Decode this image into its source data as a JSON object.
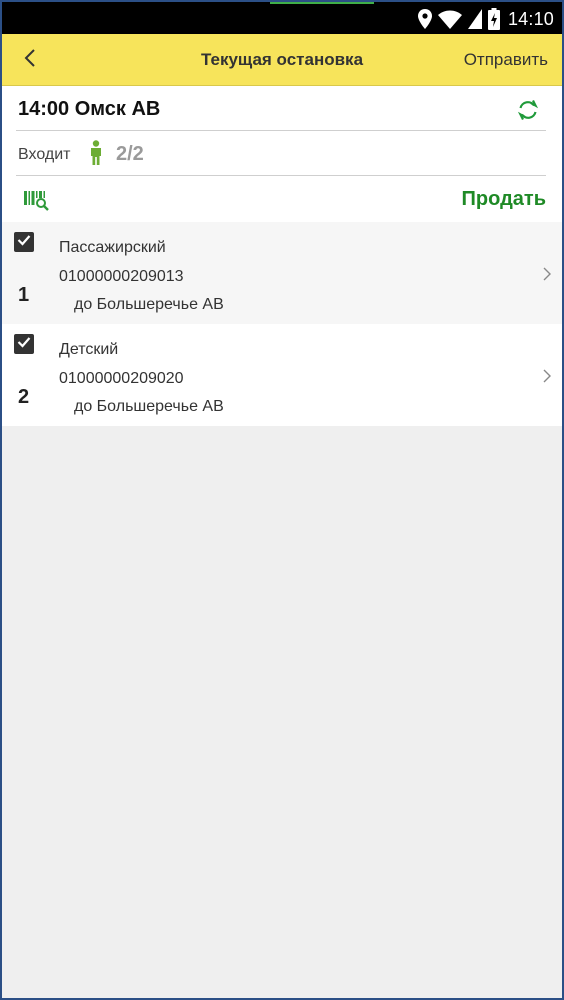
{
  "status_bar": {
    "time": "14:10",
    "icons": [
      "location-icon",
      "wifi-icon",
      "signal-icon",
      "battery-charging-icon"
    ]
  },
  "header": {
    "back_icon": "chevron-left-icon",
    "title": "Текущая остановка",
    "send_label": "Отправить"
  },
  "stop": {
    "title": "14:00 Омск АВ",
    "refresh_icon": "refresh-icon",
    "incoming_label": "Входит",
    "incoming_icon": "person-icon",
    "incoming_count": "2/2",
    "barcode_icon": "barcode-search-icon",
    "sell_label": "Продать"
  },
  "tickets": [
    {
      "checked": true,
      "number": "1",
      "type": "Пассажирский",
      "ticket_no": "01000000209013",
      "destination": "до Большеречье АВ"
    },
    {
      "checked": true,
      "number": "2",
      "type": "Детский",
      "ticket_no": "01000000209020",
      "destination": "до Большеречье АВ"
    }
  ],
  "colors": {
    "appbar": "#f7e45b",
    "accent_green": "#1f8a26",
    "icon_green": "#3fae49",
    "background": "#efefef"
  }
}
